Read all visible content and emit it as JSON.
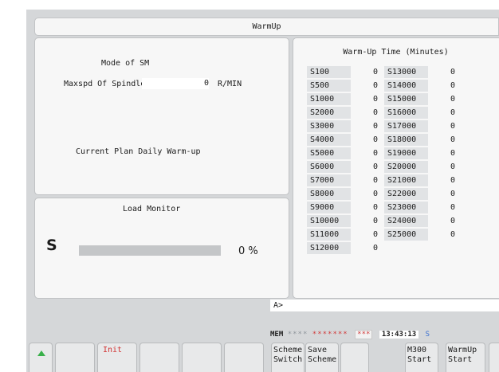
{
  "window": {
    "title": "WarmUp"
  },
  "left": {
    "mode_label": "Mode of SM",
    "maxspd_label": "Maxspd Of Spindle",
    "maxspd_value": "0",
    "maxspd_unit": "R/MIN",
    "plan_label": "Current Plan Daily Warm-up"
  },
  "load": {
    "title": "Load Monitor",
    "axis": "S",
    "percent": 0,
    "percent_text": "0 %"
  },
  "warmup_table": {
    "title": "Warm-Up Time (Minutes)",
    "rows": [
      {
        "name": "S100",
        "value": "0"
      },
      {
        "name": "S500",
        "value": "0"
      },
      {
        "name": "S1000",
        "value": "0"
      },
      {
        "name": "S2000",
        "value": "0"
      },
      {
        "name": "S3000",
        "value": "0"
      },
      {
        "name": "S4000",
        "value": "0"
      },
      {
        "name": "S5000",
        "value": "0"
      },
      {
        "name": "S6000",
        "value": "0"
      },
      {
        "name": "S7000",
        "value": "0"
      },
      {
        "name": "S8000",
        "value": "0"
      },
      {
        "name": "S9000",
        "value": "0"
      },
      {
        "name": "S10000",
        "value": "0"
      },
      {
        "name": "S11000",
        "value": "0"
      },
      {
        "name": "S12000",
        "value": "0"
      },
      {
        "name": "S13000",
        "value": "0"
      },
      {
        "name": "S14000",
        "value": "0"
      },
      {
        "name": "S15000",
        "value": "0"
      },
      {
        "name": "S16000",
        "value": "0"
      },
      {
        "name": "S17000",
        "value": "0"
      },
      {
        "name": "S18000",
        "value": "0"
      },
      {
        "name": "S19000",
        "value": "0"
      },
      {
        "name": "S20000",
        "value": "0"
      },
      {
        "name": "S21000",
        "value": "0"
      },
      {
        "name": "S22000",
        "value": "0"
      },
      {
        "name": "S23000",
        "value": "0"
      },
      {
        "name": "S24000",
        "value": "0"
      },
      {
        "name": "S25000",
        "value": "0"
      }
    ]
  },
  "command_line": {
    "prompt": "A>"
  },
  "status": {
    "mode": "MEM",
    "dots1": "****",
    "dots2": "*******",
    "dots3": "***",
    "time": "13:43:13",
    "flag": "S"
  },
  "softkeys": {
    "init": "Init",
    "scheme_switch_1": "Scheme",
    "scheme_switch_2": "Switch",
    "save_scheme_1": "Save",
    "save_scheme_2": "Scheme",
    "m300_start_1": "M300",
    "m300_start_2": "Start",
    "warmup_start_1": "WarmUp",
    "warmup_start_2": "Start"
  },
  "colors": {
    "background": "#d5d7d9",
    "panel": "#f7f7f7",
    "accent_red": "#d23535",
    "accent_green": "#39b04a",
    "accent_blue": "#3a6fd1"
  }
}
